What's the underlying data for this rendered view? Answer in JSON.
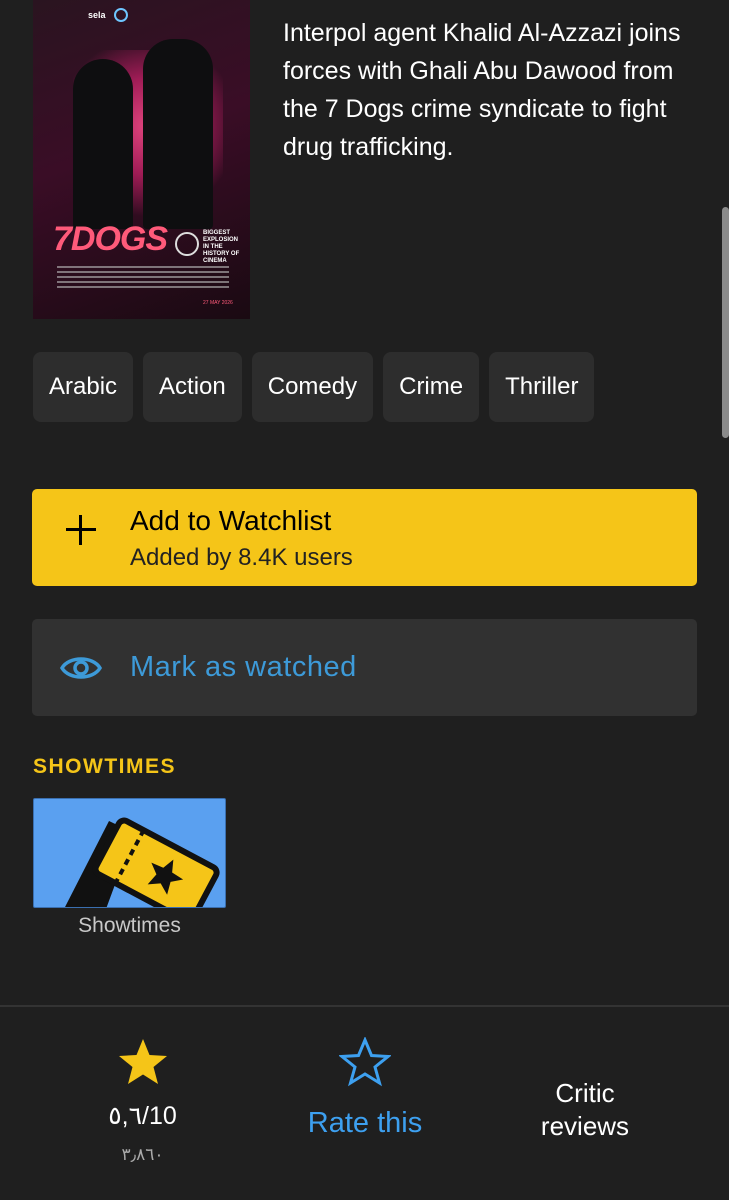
{
  "poster": {
    "title_art": "7DOGS",
    "logo_text": "sela",
    "seal_text": "BIGGEST EXPLOSION IN THE HISTORY OF CINEMA",
    "release_date": "27 MAY 2026"
  },
  "plot": "Interpol agent Khalid Al-Azzazi joins forces with Ghali Abu Dawood from the 7 Dogs crime syndicate to fight drug trafficking.",
  "genres": [
    "Arabic",
    "Action",
    "Comedy",
    "Crime",
    "Thriller"
  ],
  "watchlist": {
    "title": "Add to Watchlist",
    "subtitle": "Added by 8.4K users",
    "icon": "plus-icon",
    "color": "#f5c518"
  },
  "watched": {
    "label": "Mark as watched",
    "icon": "eye-icon",
    "color": "#3d9ad8"
  },
  "showtimes": {
    "section_title": "SHOWTIMES",
    "card_label": "Showtimes",
    "icon": "ticket-icon"
  },
  "rating": {
    "value": "٥,٦/10",
    "count": "٣٫٨٦٠",
    "icon": "star-filled-icon"
  },
  "rate": {
    "label": "Rate this",
    "icon": "star-outline-icon"
  },
  "critic": {
    "line1": "Critic",
    "line2": "reviews"
  },
  "colors": {
    "background": "#1f1f1f",
    "accent": "#f5c518",
    "link": "#3da0f0"
  }
}
